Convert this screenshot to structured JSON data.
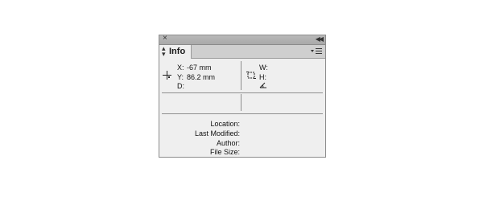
{
  "panel": {
    "tab_label": "Info",
    "position": {
      "x_label": "X:",
      "x_value": "-67 mm",
      "y_label": "Y:",
      "y_value": "86.2 mm",
      "d_label": "D:"
    },
    "size": {
      "w_label": "W:",
      "h_label": "H:"
    },
    "file_info": {
      "location_label": "Location:",
      "last_modified_label": "Last Modified:",
      "author_label": "Author:",
      "file_size_label": "File Size:"
    }
  },
  "icons": {
    "close": "close-icon",
    "collapse": "collapse-icon",
    "tab_sort": "tab-arrows-icon",
    "panel_menu": "panel-menu-icon",
    "crosshair": "crosshair-icon",
    "transform": "transform-box-icon",
    "angle": "angle-icon"
  }
}
